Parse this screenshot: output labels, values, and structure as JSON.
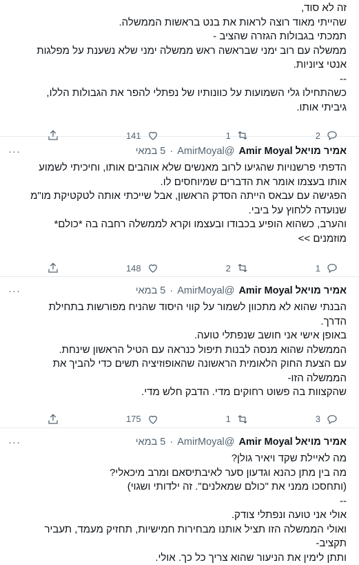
{
  "tweets": [
    {
      "header": null,
      "body": [
        "זה לא סוד,",
        "שהייתי מאוד רוצה לראות את בנט בראשות הממשלה.",
        "תמכתי בגבולות הגזרה שהציב -",
        "ממשלה עם רוב ימני שבראשה ראש ממשלה ימני שלא נשענת על מפלגות",
        "אנטי ציוניות.",
        "--",
        "כשהתחילו גלי השמועות על כוונותיו של נפתלי להפר את הגבולות הללו,",
        "גיביתי אותו."
      ],
      "likes": "141",
      "retweets": "1",
      "replies": "2"
    },
    {
      "header": {
        "name": "אמיר מויאל Amir Moyal",
        "handle": "@AmirMoyal",
        "date": "5 במאי",
        "more": "···"
      },
      "body": [
        "הדפתי פרשנויות שהגיעו לרוב מאנשים שלא אוהבים אותו, וחיכיתי לשמוע",
        "אותו בעצמו אומר את הדברים שמיוחסים לו.",
        "הפגישה עם עבאס הייתה הסדק הראשון, אבל שייכתי אותה לטקטיקת מו\"מ",
        "שנועדה ללחוץ על ביבי.",
        "והערב, כשהוא הופיע בכבודו ובעצמו וקרא לממשלה רחבה בה *כולם*",
        "מוזמנים >>"
      ],
      "likes": "148",
      "retweets": "2",
      "replies": "1"
    },
    {
      "header": {
        "name": "אמיר מויאל Amir Moyal",
        "handle": "@AmirMoyal",
        "date": "5 במאי",
        "more": "···"
      },
      "body": [
        "הבנתי שהוא לא מתכוון לשמור על קווי היסוד שהניח מפורשות בתחילת",
        "הדרך.",
        "באופן אישי אני חושב שנפתלי טועה.",
        "הממשלה שהוא מנסה לבנות תיפול כנראה עם הטיל הראשון שינחת.",
        "עם הצעת החוק הלאומית הראשונה שהאופוזיציה תשים כדי להביך את",
        "הממשלה הזו-",
        "שהקצוות בה פשוט רחוקים מדי. הדבק חלש מדי."
      ],
      "likes": "175",
      "retweets": "1",
      "replies": "3"
    },
    {
      "header": {
        "name": "אמיר מויאל Amir Moyal",
        "handle": "@AmirMoyal",
        "date": "5 במאי",
        "more": "···"
      },
      "body": [
        "מה לאיילת שקד ויאיר גולן?",
        "מה בין מתן כהנא וגדעון סער לאיבתיסאם ומרב מיכאלי?",
        "(ותחסכו ממני את \"כולם שמאלנים\". זה ילדותי ושגוי)",
        "--",
        "אולי אני טועה ונפתלי צודק.",
        "ואולי הממשלה הזו תציל אותנו מבחירות חמישיות, תחזיק מעמד, תעביר",
        "תקציב-",
        "ותתן לימין את הניעור שהוא צריך כל כך. אולי."
      ],
      "likes": "",
      "retweets": "",
      "replies": ""
    }
  ]
}
